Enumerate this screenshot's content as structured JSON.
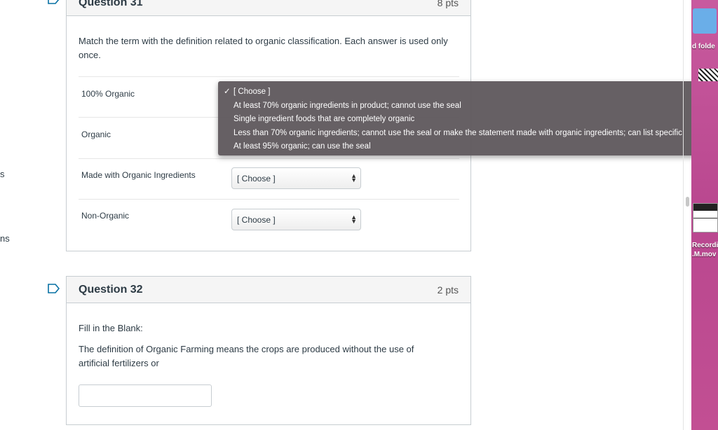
{
  "left_fragments": {
    "s": "s",
    "ns": "ns"
  },
  "q31": {
    "title": "Question 31",
    "points": "8 pts",
    "prompt": "Match the term with the definition related to organic classification.  Each answer is used only once.",
    "rows": [
      {
        "label": "100% Organic",
        "value": "[ Choose ]"
      },
      {
        "label": "Organic",
        "value": "[ Choose ]"
      },
      {
        "label": "Made with Organic Ingredients",
        "value": "[ Choose ]"
      },
      {
        "label": "Non-Organic",
        "value": "[ Choose ]"
      }
    ]
  },
  "dropdown": {
    "check": "✓",
    "options": [
      "[ Choose ]",
      "At least 70% organic ingredients in product; cannot use the seal",
      "Single ingredient foods that are completely organic",
      "Less than 70% organic ingredients; cannot use the seal or make the statement made with organic ingredients; can list specific",
      "At least 95% organic; can use the seal"
    ]
  },
  "q32": {
    "title": "Question 32",
    "points": "2 pts",
    "line1": "Fill in the Blank:",
    "line2": "The definition of Organic Farming means the crops are produced without the use of artificial fertilizers or",
    "answer_value": ""
  },
  "desktop": {
    "folder_label": "d folde",
    "recording_label1": "Recordi",
    "recording_label2": ".M.mov"
  },
  "colors": {
    "border": "#c7cdd1",
    "header_bg": "#f5f5f5",
    "text": "#2d3b45",
    "dropdown_bg": "#605a5e",
    "bookmark": "#0770a3",
    "desktop_bg": "#c24f93"
  }
}
